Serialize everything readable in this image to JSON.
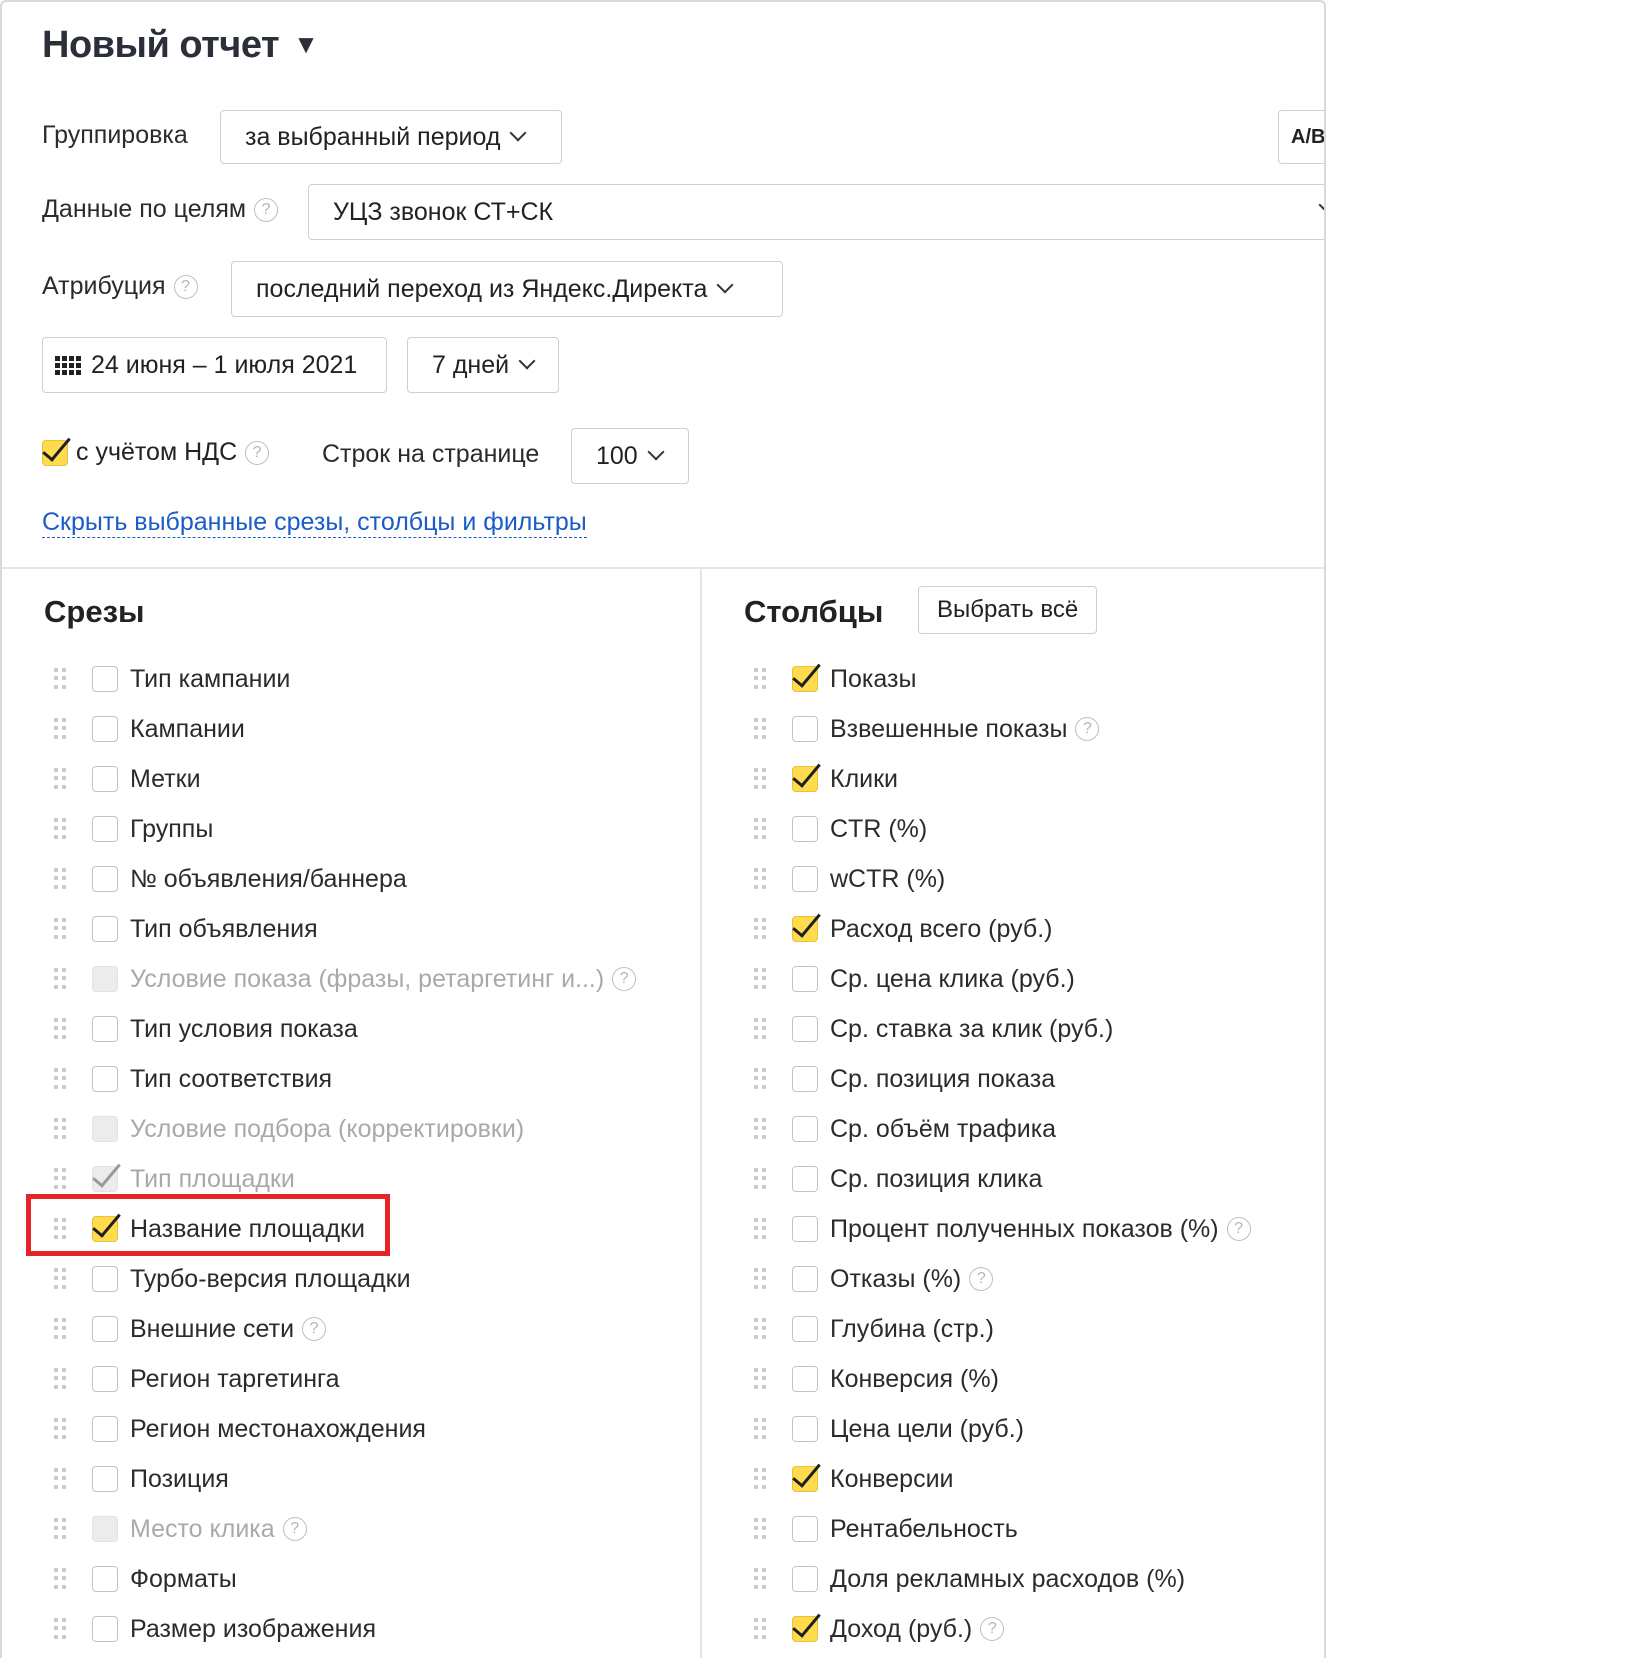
{
  "report": {
    "title": "Новый отчет",
    "title_caret": "▼"
  },
  "grouping": {
    "label": "Группировка",
    "value": "за выбранный период"
  },
  "ab_button": {
    "label": "A/B"
  },
  "goals": {
    "label": "Данные по целям",
    "value": "УЦЗ звонок СТ+СК"
  },
  "attribution": {
    "label": "Атрибуция",
    "value": "последний переход из Яндекс.Директа"
  },
  "period": {
    "range": "24 июня – 1 июля 2021",
    "preset": "7 дней"
  },
  "vat": {
    "label": "с учётом НДС",
    "checked": true
  },
  "rows_per_page": {
    "label": "Строк на странице",
    "value": "100"
  },
  "toggle_link": "Скрыть выбранные срезы, столбцы и фильтры",
  "help_glyph": "?",
  "slices": {
    "title": "Срезы",
    "items": [
      {
        "label": "Тип кампании",
        "state": "unchecked",
        "help": false
      },
      {
        "label": "Кампании",
        "state": "unchecked",
        "help": false
      },
      {
        "label": "Метки",
        "state": "unchecked",
        "help": false
      },
      {
        "label": "Группы",
        "state": "unchecked",
        "help": false
      },
      {
        "label": "№ объявления/баннера",
        "state": "unchecked",
        "help": false
      },
      {
        "label": "Тип объявления",
        "state": "unchecked",
        "help": false
      },
      {
        "label": "Условие показа (фразы, ретаргетинг и...)",
        "state": "disabled",
        "help": true
      },
      {
        "label": "Тип условия показа",
        "state": "unchecked",
        "help": false
      },
      {
        "label": "Тип соответствия",
        "state": "unchecked",
        "help": false
      },
      {
        "label": "Условие подбора (корректировки)",
        "state": "disabled",
        "help": false
      },
      {
        "label": "Тип площадки",
        "state": "disabled-checked",
        "help": false
      },
      {
        "label": "Название площадки",
        "state": "checked",
        "help": false
      },
      {
        "label": "Турбо-версия площадки",
        "state": "unchecked",
        "help": false
      },
      {
        "label": "Внешние сети",
        "state": "unchecked",
        "help": true
      },
      {
        "label": "Регион таргетинга",
        "state": "unchecked",
        "help": false
      },
      {
        "label": "Регион местонахождения",
        "state": "unchecked",
        "help": false
      },
      {
        "label": "Позиция",
        "state": "unchecked",
        "help": false
      },
      {
        "label": "Место клика",
        "state": "disabled",
        "help": true
      },
      {
        "label": "Форматы",
        "state": "unchecked",
        "help": false
      },
      {
        "label": "Размер изображения",
        "state": "unchecked",
        "help": false
      }
    ]
  },
  "columns": {
    "title": "Столбцы",
    "select_all": "Выбрать всё",
    "items": [
      {
        "label": "Показы",
        "state": "checked",
        "help": false
      },
      {
        "label": "Взвешенные показы",
        "state": "unchecked",
        "help": true
      },
      {
        "label": "Клики",
        "state": "checked",
        "help": false
      },
      {
        "label": "CTR (%)",
        "state": "unchecked",
        "help": false
      },
      {
        "label": "wCTR (%)",
        "state": "unchecked",
        "help": false
      },
      {
        "label": "Расход всего (руб.)",
        "state": "checked",
        "help": false
      },
      {
        "label": "Ср. цена клика (руб.)",
        "state": "unchecked",
        "help": false
      },
      {
        "label": "Ср. ставка за клик (руб.)",
        "state": "unchecked",
        "help": false
      },
      {
        "label": "Ср. позиция показа",
        "state": "unchecked",
        "help": false
      },
      {
        "label": "Ср. объём трафика",
        "state": "unchecked",
        "help": false
      },
      {
        "label": "Ср. позиция клика",
        "state": "unchecked",
        "help": false
      },
      {
        "label": "Процент полученных показов (%)",
        "state": "unchecked",
        "help": true
      },
      {
        "label": "Отказы (%)",
        "state": "unchecked",
        "help": true
      },
      {
        "label": "Глубина (стр.)",
        "state": "unchecked",
        "help": false
      },
      {
        "label": "Конверсия (%)",
        "state": "unchecked",
        "help": false
      },
      {
        "label": "Цена цели (руб.)",
        "state": "unchecked",
        "help": false
      },
      {
        "label": "Конверсии",
        "state": "checked",
        "help": false
      },
      {
        "label": "Рентабельность",
        "state": "unchecked",
        "help": false
      },
      {
        "label": "Доля рекламных расходов (%)",
        "state": "unchecked",
        "help": false
      },
      {
        "label": "Доход (руб.)",
        "state": "checked",
        "help": true
      }
    ]
  },
  "colors": {
    "accent_checkbox": "#ffdb4d",
    "link": "#1a5cc8",
    "highlight": "#e5232a"
  }
}
